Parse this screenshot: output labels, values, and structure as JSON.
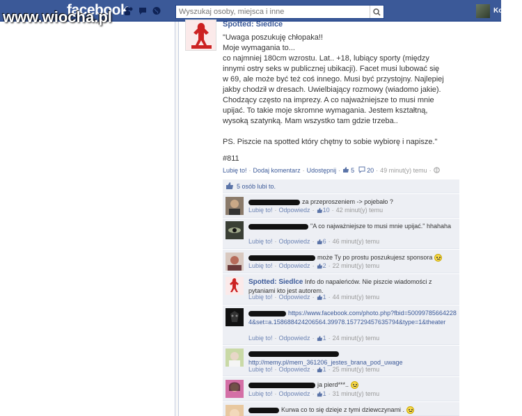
{
  "watermark": "www.wiocha.pl",
  "header": {
    "logo": "facebook",
    "search_placeholder": "Wyszukaj osoby, miejsca i inne",
    "user_name": "Ko"
  },
  "post": {
    "author": "Spotted: Siedlce",
    "text": "\"Uwaga poszukuję chłopaka!!\nMoje wymagania to...\nco najmniej 180cm wzrostu. Lat.. +18, lubiący sporty (między innymi ostry seks w publicznej ubikacji). Facet musi lubować się w 69, ale może być też coś innego. Musi być przystojny. Najlepiej jakby chodził w dresach. Uwielbiający rozmowy (wiadomo jakie). Chodzący często na imprezy. A co najważniejsze to musi mnie upijać. To takie moje skromne wymagania. Jestem kształtną, wysoką szatynką. Mam wszystko tam gdzie trzeba..\n\nPS. Piszcie na spotted który chętny to sobie wybiorę i napisze.\"",
    "tag": "#811",
    "actions": {
      "like": "Lubię to!",
      "comment": "Dodaj komentarz",
      "share": "Udostępnij",
      "likes_count": "5",
      "comments_count": "20",
      "time": "49 minut(y) temu"
    }
  },
  "likes_summary": "5 osób lubi to.",
  "comments": [
    {
      "name_visible": "",
      "text": "za przeproszeniem -> pojebało ?",
      "likes": "10",
      "time": "42 minut(y) temu"
    },
    {
      "name_visible": "",
      "text": "\"A co najważniejsze to musi mnie upijać.\" hhahaha",
      "likes": "6",
      "time": "46 minut(y) temu"
    },
    {
      "name_visible": "",
      "text": "może Ty po prostu poszukujesz sponsora",
      "likes": "2",
      "time": "22 minut(y) temu"
    },
    {
      "name_visible": "Spotted: Siedlce",
      "text": "Info do napaleńców. Nie piszcie wiadomości z pytaniami kto jest autorem.",
      "likes": "1",
      "time": "44 minut(y) temu"
    },
    {
      "name_visible": "",
      "text": "https://www.facebook.com/photo.php?fbid=500997856642284&set=a.158688424206564.39978.157729457635794&type=1&theater",
      "likes": "1",
      "time": "24 minut(y) temu"
    },
    {
      "name_visible": "",
      "text": "http://memy.pl/mem_361206_jestes_brana_pod_uwage",
      "likes": "1",
      "time": "25 minut(y) temu"
    },
    {
      "name_visible": "",
      "text": "ja pierd***..",
      "likes": "1",
      "time": "31 minut(y) temu"
    },
    {
      "name_visible": "",
      "text": "Kurwa co to się dzieje z tymi dziewczynami .",
      "likes": "",
      "time": ""
    }
  ],
  "labels": {
    "like": "Lubię to!",
    "reply": "Odpowiedz"
  },
  "colors": {
    "brand_blue": "#3b5998",
    "link_blue": "#3b5998",
    "meta_blue": "#6d84b4",
    "comment_bg": "#edeff4"
  }
}
